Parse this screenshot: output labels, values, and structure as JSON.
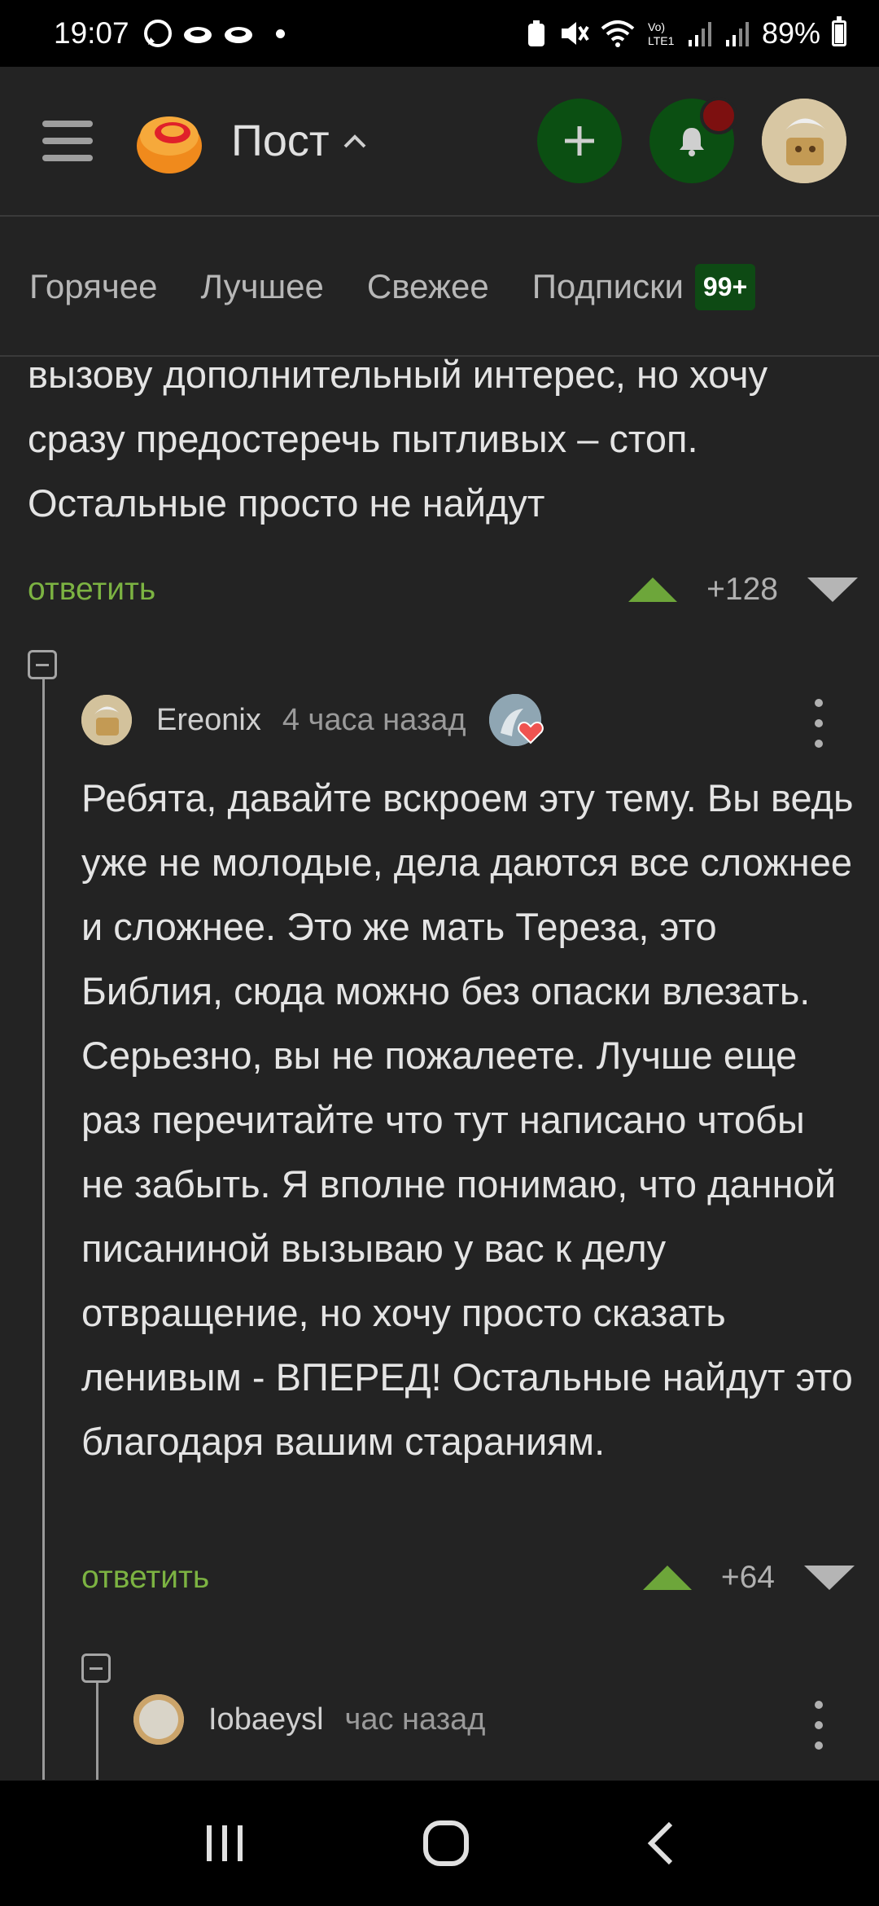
{
  "status_bar": {
    "time": "19:07",
    "battery": "89%",
    "battery_level": 0.89
  },
  "header": {
    "title": "Пост"
  },
  "tabs": [
    {
      "label": "Горячее"
    },
    {
      "label": "Лучшее"
    },
    {
      "label": "Свежее"
    },
    {
      "label": "Подписки",
      "badge": "99+"
    }
  ],
  "comments": [
    {
      "text": "вызову дополнительный интерес, но хочу сразу предостеречь пытливых – стоп. Остальные просто не найдут",
      "reply_label": "ответить",
      "rating": "+128"
    },
    {
      "username": "Ereonix",
      "time": "4 часа назад",
      "text": "Ребята, давайте вскроем эту тему. Вы ведь уже не молодые, дела даются все сложнее и сложнее. Это же мать Тереза, это Библия, сюда можно без опаски влезать. Серьезно, вы не пожалеете. Лучше еще раз перечитайте что тут написано чтобы не забыть. Я вполне понимаю, что данной писаниной вызываю у вас к делу отвращение, но хочу просто сказать ленивым - ВПЕРЕД! Остальные найдут это благодаря вашим стараниям.",
      "reply_label": "ответить",
      "rating": "+64"
    },
    {
      "username": "Iobaeysl",
      "time": "час назад"
    }
  ],
  "colors": {
    "background": "#232323",
    "accent_green": "#7cb342",
    "button_green": "#0b4f12",
    "notification_red": "#7d1010"
  },
  "icons": [
    "menu-icon",
    "pikabu-logo",
    "chevron-up-icon",
    "plus-icon",
    "bell-icon",
    "whatsapp-icon",
    "recents-icon",
    "home-icon",
    "back-icon"
  ]
}
